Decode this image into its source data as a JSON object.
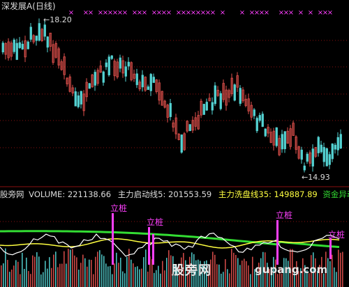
{
  "header": {
    "title": "深发展A(日线)",
    "high_label": "18.20",
    "low_label": "14.93",
    "x_marker": "×"
  },
  "indicator": {
    "source_label": "股旁网",
    "volume_label": "VOLUME: 221138.66",
    "line1_label": "主力启动线5: 201553.59",
    "line2_label": "主力洗盘线35: 149887.89",
    "line3_label": "资金异动",
    "signal_text": "立桩"
  },
  "watermark": {
    "cn": "股旁网",
    "url": "gupang.com"
  },
  "colors": {
    "up": "#e0504c",
    "down": "#54d3d3",
    "grid": "#8a1010",
    "marker": "#ff40ff",
    "line_green": "#33dd33",
    "line_yellow": "#ffff40",
    "line_white": "#ffffff",
    "signal_bar": "#ff40ff",
    "text": "#dcdcdc"
  },
  "chart_data": {
    "type": "candlestick",
    "title": "深发展A(日线)",
    "annotations": [
      {
        "label": "18.20",
        "kind": "high"
      },
      {
        "label": "14.93",
        "kind": "low"
      }
    ],
    "series": [
      {
        "name": "VOLUME",
        "value": 221138.66
      },
      {
        "name": "主力启动线5",
        "value": 201553.59
      },
      {
        "name": "主力洗盘线35",
        "value": 149887.89
      },
      {
        "name": "资金异动"
      }
    ]
  }
}
